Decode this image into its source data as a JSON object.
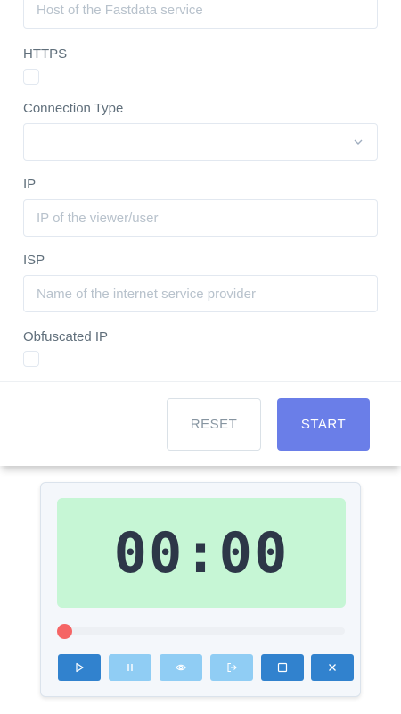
{
  "form": {
    "host_placeholder": "Host of the Fastdata service",
    "https_label": "HTTPS",
    "connection_type_label": "Connection Type",
    "connection_type_value": "",
    "ip_label": "IP",
    "ip_placeholder": "IP of the viewer/user",
    "isp_label": "ISP",
    "isp_placeholder": "Name of the internet service provider",
    "obfuscated_ip_label": "Obfuscated IP",
    "reset_label": "RESET",
    "start_label": "START"
  },
  "player": {
    "time": "00:00",
    "progress": 0,
    "controls": [
      {
        "icon": "play-icon",
        "color": "#3182ce"
      },
      {
        "icon": "pause-icon",
        "color": "#90cdf4"
      },
      {
        "icon": "eye-icon",
        "color": "#90cdf4"
      },
      {
        "icon": "exit-icon",
        "color": "#90cdf4"
      },
      {
        "icon": "stop-icon",
        "color": "#3182ce"
      },
      {
        "icon": "close-icon",
        "color": "#3182ce"
      }
    ]
  },
  "colors": {
    "accent": "#6a7ee8",
    "timer_bg": "#c6f6d5",
    "thumb": "#f56565"
  }
}
